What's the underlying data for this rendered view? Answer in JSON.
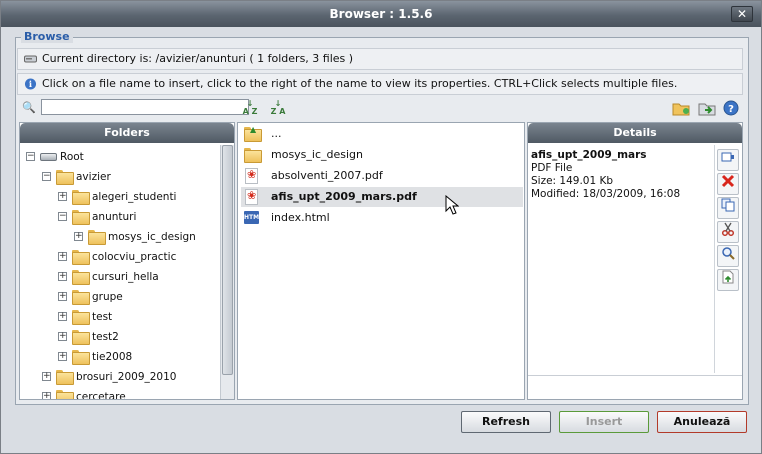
{
  "window": {
    "title": "Browser : 1.5.6",
    "close_label": "✕"
  },
  "browse_legend": "Browse",
  "current_dir": "Current directory is: /avizier/anunturi ( 1 folders, 3 files )",
  "hint": "Click on a file name to insert, click to the right of the name to view its properties. CTRL+Click selects multiple files.",
  "search": {
    "value": "",
    "placeholder": ""
  },
  "folders_panel": {
    "title": "Folders",
    "tree": [
      {
        "label": "Root",
        "type": "drive",
        "expander": "−"
      },
      {
        "label": "avizier",
        "type": "folder",
        "expander": "−"
      },
      {
        "label": "alegeri_studenti",
        "type": "folder",
        "expander": "+"
      },
      {
        "label": "anunturi",
        "type": "folder",
        "expander": "−"
      },
      {
        "label": "mosys_ic_design",
        "type": "folder",
        "expander": "+"
      },
      {
        "label": "colocviu_practic",
        "type": "folder",
        "expander": "+"
      },
      {
        "label": "cursuri_hella",
        "type": "folder",
        "expander": "+"
      },
      {
        "label": "grupe",
        "type": "folder",
        "expander": "+"
      },
      {
        "label": "test",
        "type": "folder",
        "expander": "+"
      },
      {
        "label": "test2",
        "type": "folder",
        "expander": "+"
      },
      {
        "label": "tie2008",
        "type": "folder",
        "expander": "+"
      },
      {
        "label": "brosuri_2009_2010",
        "type": "folder",
        "expander": "+"
      },
      {
        "label": "cercetare",
        "type": "folder",
        "expander": "+"
      }
    ]
  },
  "files": [
    {
      "label": "...",
      "icon": "folder-up-icon"
    },
    {
      "label": "mosys_ic_design",
      "icon": "folder-icon"
    },
    {
      "label": "absolventi_2007.pdf",
      "icon": "pdf-icon"
    },
    {
      "label": "afis_upt_2009_mars.pdf",
      "icon": "pdf-icon",
      "selected": true
    },
    {
      "label": "index.html",
      "icon": "html-icon"
    }
  ],
  "details_panel": {
    "title": "Details",
    "name": "afis_upt_2009_mars",
    "type": "PDF File",
    "size": "Size: 149.01 Kb",
    "modified": "Modified: 18/03/2009, 16:08",
    "actions": [
      "insert-icon",
      "delete-icon",
      "copy-icon",
      "cut-icon",
      "preview-icon",
      "upload-file-icon"
    ]
  },
  "buttons": {
    "refresh": "Refresh",
    "insert": "Insert",
    "cancel": "Anulează"
  },
  "colors": {
    "accent": "#2a5da8",
    "insert_border": "#5a9a3a",
    "cancel_border": "#b23a2a",
    "selected_row": "#dfe1e4"
  }
}
